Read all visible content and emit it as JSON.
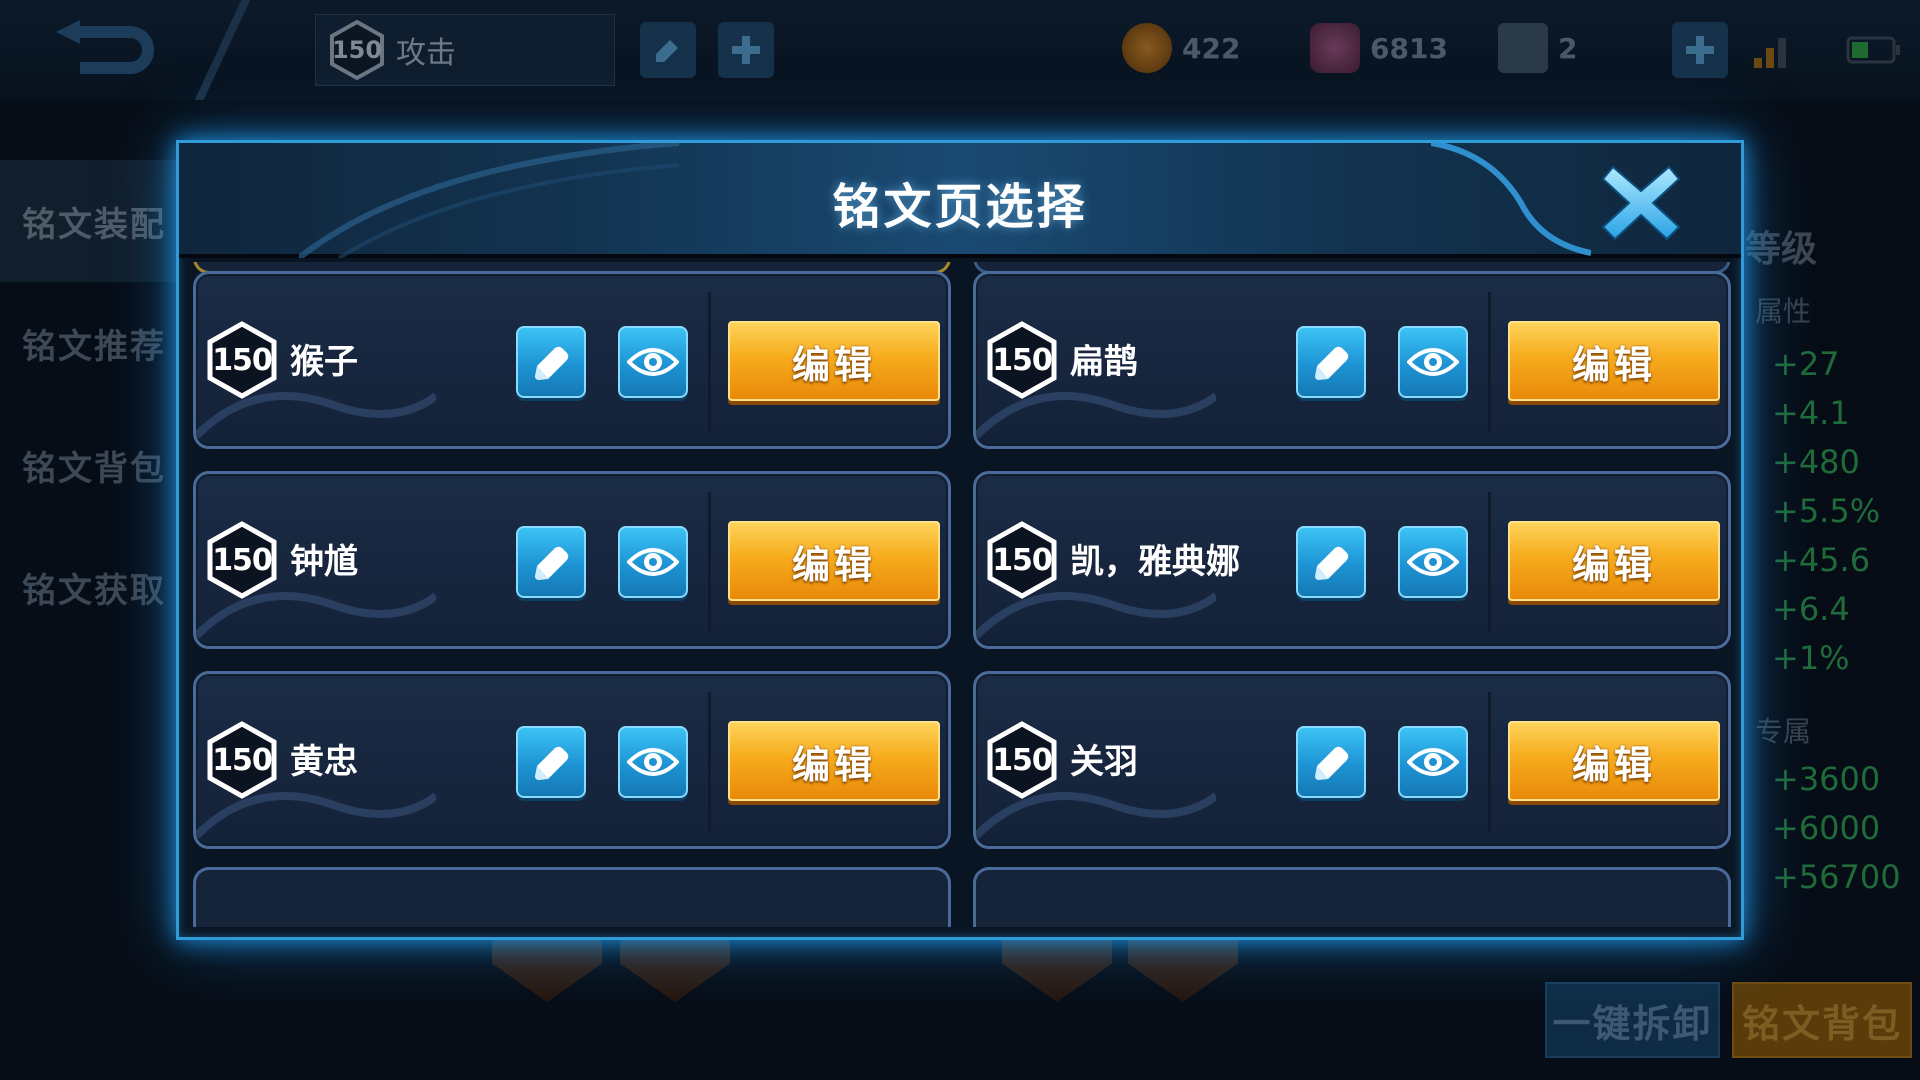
{
  "topbar": {
    "hero_level": "150",
    "hero_name": "攻击",
    "gold": "422",
    "diamonds": "6813",
    "vouchers": "2"
  },
  "left_nav": [
    {
      "label": "铭文装配"
    },
    {
      "label": "铭文推荐"
    },
    {
      "label": "铭文背包"
    },
    {
      "label": "铭文获取"
    }
  ],
  "right_panel": {
    "level_label": "等级",
    "attr_label": "属性",
    "stats": [
      "+27",
      "+4.1",
      "+480",
      "+5.5%",
      "+45.6",
      "+6.4",
      "+1%"
    ],
    "exclusive_label": "专属",
    "exclusive_stats": [
      "+3600",
      "+6000",
      "+56700"
    ]
  },
  "bottom": {
    "unequip_all": "一键拆卸",
    "rune_bag": "铭文背包"
  },
  "dialog": {
    "title": "铭文页选择",
    "edit_label": "编辑",
    "pages": [
      {
        "level": "150",
        "name": "猴子"
      },
      {
        "level": "150",
        "name": "扁鹊"
      },
      {
        "level": "150",
        "name": "钟馗"
      },
      {
        "level": "150",
        "name": "凯，雅典娜"
      },
      {
        "level": "150",
        "name": "黄忠"
      },
      {
        "level": "150",
        "name": "关羽"
      }
    ]
  },
  "colors": {
    "accent_blue": "#2f9bd8",
    "edit_gold": "#f6ab1c",
    "stat_green": "#1f6b3a"
  },
  "icons": [
    "back-arrow-icon",
    "pencil-icon",
    "plus-icon",
    "gold-coin-icon",
    "diamond-icon",
    "voucher-icon",
    "signal-icon",
    "battery-icon",
    "close-icon",
    "eye-icon"
  ]
}
